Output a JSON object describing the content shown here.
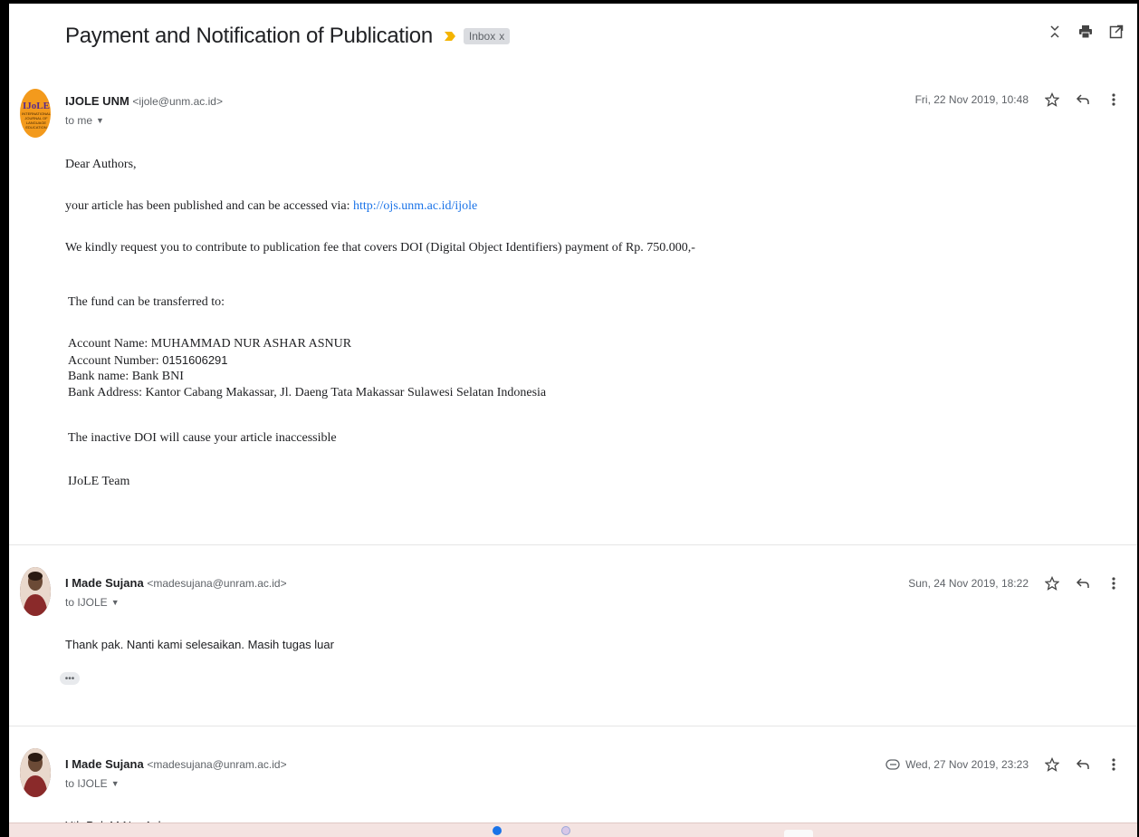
{
  "thread": {
    "subject": "Payment and Notification of Publication",
    "label": "Inbox",
    "label_close": "x"
  },
  "top_icons": [
    "collapse-all-icon",
    "print-icon",
    "open-in-new-window-icon"
  ],
  "messages": [
    {
      "sender_name": "IJOLE UNM",
      "sender_email": "<ijole@unm.ac.id>",
      "to": "to me",
      "date": "Fri, 22 Nov 2019, 10:48",
      "avatar": {
        "text": "IJoLE",
        "subtext": "INTERNATIONAL JOURNAL OF LANGUAGE EDUCATION"
      },
      "body": {
        "greeting": "Dear Authors,",
        "published_prefix": "your article has been published and can be accessed via: ",
        "published_link": "http://ojs.unm.ac.id/ijole",
        "request": "We kindly request you to contribute to publication fee that covers DOI (Digital Object Identifiers) payment of Rp. 750.000,-",
        "transfer_intro": "The fund can be transferred to:",
        "account_name": "Account Name: MUHAMMAD NUR ASHAR ASNUR",
        "account_number_label": "Account Number: ",
        "account_number_value": "0151606291",
        "bank_name": "Bank name: Bank BNI",
        "bank_address": "Bank Address: Kantor Cabang Makassar, Jl. Daeng Tata Makassar Sulawesi Selatan Indonesia",
        "warning": "The inactive DOI will cause your article inaccessible",
        "signature": "IJoLE Team"
      }
    },
    {
      "sender_name": "I Made Sujana",
      "sender_email": "<madesujana@unram.ac.id>",
      "to": "to IJOLE",
      "date": "Sun, 24 Nov 2019, 18:22",
      "body": {
        "text": "Thank pak. Nanti kami selesaikan. Masih tugas luar"
      }
    },
    {
      "sender_name": "I Made Sujana",
      "sender_email": "<madesujana@unram.ac.id>",
      "to": "to IJOLE",
      "date": "Wed, 27 Nov 2019, 23:23",
      "has_attachment": true,
      "body": {
        "text": "Yth Pak M Nur Ashar"
      }
    }
  ],
  "colors": {
    "link": "#1a73e8",
    "importance": "#f4b400",
    "text": "#202124",
    "muted": "#5f6368"
  }
}
